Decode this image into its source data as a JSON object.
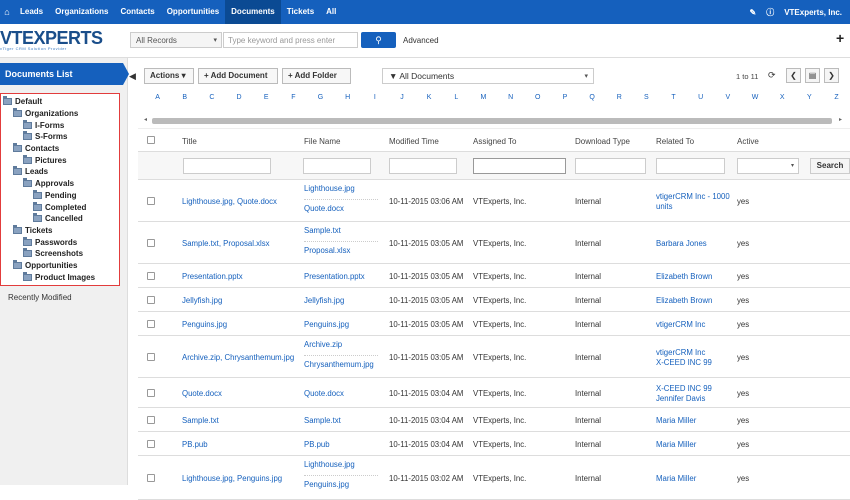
{
  "topnav": {
    "items": [
      "Leads",
      "Organizations",
      "Contacts",
      "Opportunities",
      "Documents",
      "Tickets",
      "All"
    ],
    "active": "Documents",
    "user": "VTExperts, Inc."
  },
  "header": {
    "logo": "VTEXPERTS",
    "logo_tagline": "vTiger CRM Solution Provider",
    "records_select": "All Records",
    "search_placeholder": "Type keyword and press enter",
    "advanced_label": "Advanced"
  },
  "sidebar": {
    "title": "Documents List",
    "tree": [
      {
        "label": "Default",
        "indent": 0
      },
      {
        "label": "Organizations",
        "indent": 1
      },
      {
        "label": "I-Forms",
        "indent": 2
      },
      {
        "label": "S-Forms",
        "indent": 2
      },
      {
        "label": "Contacts",
        "indent": 1
      },
      {
        "label": "Pictures",
        "indent": 2
      },
      {
        "label": "Leads",
        "indent": 1
      },
      {
        "label": "Approvals",
        "indent": 2
      },
      {
        "label": "Pending",
        "indent": 3
      },
      {
        "label": "Completed",
        "indent": 3
      },
      {
        "label": "Cancelled",
        "indent": 3
      },
      {
        "label": "Tickets",
        "indent": 1
      },
      {
        "label": "Passwords",
        "indent": 2
      },
      {
        "label": "Screenshots",
        "indent": 2
      },
      {
        "label": "Opportunities",
        "indent": 1
      },
      {
        "label": "Product Images",
        "indent": 2
      }
    ],
    "recent_label": "Recently Modified"
  },
  "toolbar": {
    "actions_label": "Actions",
    "add_document_label": "+ Add Document",
    "add_folder_label": "+ Add Folder",
    "filter_label": "All Documents",
    "pager_text": "1 to 11"
  },
  "alphabet": [
    "A",
    "B",
    "C",
    "D",
    "E",
    "F",
    "G",
    "H",
    "I",
    "J",
    "K",
    "L",
    "M",
    "N",
    "O",
    "P",
    "Q",
    "R",
    "S",
    "T",
    "U",
    "V",
    "W",
    "X",
    "Y",
    "Z"
  ],
  "table": {
    "columns": [
      "Title",
      "File Name",
      "Modified Time",
      "Assigned To",
      "Download Type",
      "Related To",
      "Active"
    ],
    "search_label": "Search",
    "rows": [
      {
        "title": "Lighthouse.jpg, Quote.docx",
        "files": [
          "Lighthouse.jpg",
          "Quote.docx"
        ],
        "modified": "10-11-2015 03:06 AM",
        "assigned": "VTExperts, Inc.",
        "download": "Internal",
        "related": [
          "vtigerCRM Inc - 1000",
          "units"
        ],
        "active": "yes"
      },
      {
        "title": "Sample.txt, Proposal.xlsx",
        "files": [
          "Sample.txt",
          "Proposal.xlsx"
        ],
        "modified": "10-11-2015 03:05 AM",
        "assigned": "VTExperts, Inc.",
        "download": "Internal",
        "related": [
          "Barbara Jones"
        ],
        "active": "yes"
      },
      {
        "title": "Presentation.pptx",
        "files": [
          "Presentation.pptx"
        ],
        "modified": "10-11-2015 03:05 AM",
        "assigned": "VTExperts, Inc.",
        "download": "Internal",
        "related": [
          "Elizabeth Brown"
        ],
        "active": "yes"
      },
      {
        "title": "Jellyfish.jpg",
        "files": [
          "Jellyfish.jpg"
        ],
        "modified": "10-11-2015 03:05 AM",
        "assigned": "VTExperts, Inc.",
        "download": "Internal",
        "related": [
          "Elizabeth Brown"
        ],
        "active": "yes"
      },
      {
        "title": "Penguins.jpg",
        "files": [
          "Penguins.jpg"
        ],
        "modified": "10-11-2015 03:05 AM",
        "assigned": "VTExperts, Inc.",
        "download": "Internal",
        "related": [
          "vtigerCRM Inc"
        ],
        "active": "yes"
      },
      {
        "title": "Archive.zip, Chrysanthemum.jpg",
        "files": [
          "Archive.zip",
          "Chrysanthemum.jpg"
        ],
        "modified": "10-11-2015 03:05 AM",
        "assigned": "VTExperts, Inc.",
        "download": "Internal",
        "related": [
          "vtigerCRM Inc",
          "X-CEED INC 99"
        ],
        "active": "yes"
      },
      {
        "title": "Quote.docx",
        "files": [
          "Quote.docx"
        ],
        "modified": "10-11-2015 03:04 AM",
        "assigned": "VTExperts, Inc.",
        "download": "Internal",
        "related": [
          "X-CEED INC 99",
          "Jennifer Davis"
        ],
        "active": "yes"
      },
      {
        "title": "Sample.txt",
        "files": [
          "Sample.txt"
        ],
        "modified": "10-11-2015 03:04 AM",
        "assigned": "VTExperts, Inc.",
        "download": "Internal",
        "related": [
          "Maria Miller"
        ],
        "active": "yes"
      },
      {
        "title": "PB.pub",
        "files": [
          "PB.pub"
        ],
        "modified": "10-11-2015 03:04 AM",
        "assigned": "VTExperts, Inc.",
        "download": "Internal",
        "related": [
          "Maria Miller"
        ],
        "active": "yes"
      },
      {
        "title": "Lighthouse.jpg, Penguins.jpg",
        "files": [
          "Lighthouse.jpg",
          "Penguins.jpg"
        ],
        "modified": "10-11-2015 03:02 AM",
        "assigned": "VTExperts, Inc.",
        "download": "Internal",
        "related": [
          "Maria Miller"
        ],
        "active": "yes"
      }
    ]
  }
}
